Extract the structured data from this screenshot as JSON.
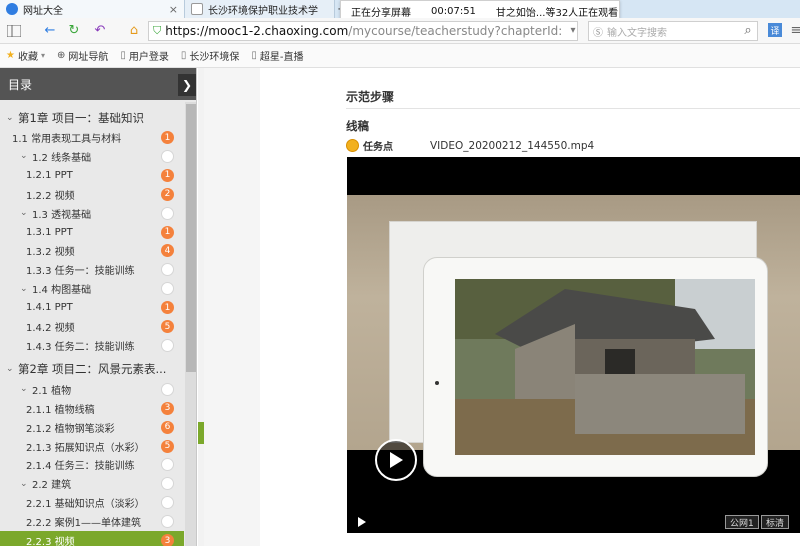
{
  "tabs": [
    {
      "title": "网址大全",
      "close": "×"
    },
    {
      "title": "长沙环境保护职业技术学",
      "close": "×"
    }
  ],
  "new_tab": "+",
  "share_overlay": {
    "status": "正在分享屏幕",
    "elapsed": "00:07:51",
    "viewers": "甘之如饴...等32人正在观看"
  },
  "address": {
    "url_main": "https://mooc1-2.chaoxing.com",
    "url_rest": "/mycourse/teacherstudy?chapterId:",
    "search_placeholder": "输入文字搜索"
  },
  "bookmarks": [
    {
      "label": "收藏"
    },
    {
      "label": "网址导航"
    },
    {
      "label": "用户登录"
    },
    {
      "label": "长沙环境保"
    },
    {
      "label": "超星-直播"
    }
  ],
  "sidebar": {
    "title": "目录",
    "items": [
      {
        "label": "第1章 项目一：基础知识",
        "level": 0,
        "caret": "v",
        "badge": ""
      },
      {
        "label": "1.1 常用表现工具与材料",
        "level": 1,
        "caret": "",
        "badge": "1"
      },
      {
        "label": "1.2 线条基础",
        "level": 2,
        "caret": "v",
        "badge": ""
      },
      {
        "label": "1.2.1 PPT",
        "level": 3,
        "caret": "",
        "badge": "1"
      },
      {
        "label": "1.2.2 视频",
        "level": 3,
        "caret": "",
        "badge": "2"
      },
      {
        "label": "1.3 透视基础",
        "level": 2,
        "caret": "v",
        "badge": ""
      },
      {
        "label": "1.3.1 PPT",
        "level": 3,
        "caret": "",
        "badge": "1"
      },
      {
        "label": "1.3.2 视频",
        "level": 3,
        "caret": "",
        "badge": "4"
      },
      {
        "label": "1.3.3 任务一：技能训练",
        "level": 3,
        "caret": "",
        "badge": ""
      },
      {
        "label": "1.4 构图基础",
        "level": 2,
        "caret": "v",
        "badge": ""
      },
      {
        "label": "1.4.1 PPT",
        "level": 3,
        "caret": "",
        "badge": "1"
      },
      {
        "label": "1.4.2 视频",
        "level": 3,
        "caret": "",
        "badge": "5"
      },
      {
        "label": "1.4.3 任务二：技能训练",
        "level": 3,
        "caret": "",
        "badge": ""
      },
      {
        "label": "第2章 项目二：风景元素表...",
        "level": 0,
        "caret": "v",
        "badge": ""
      },
      {
        "label": "2.1 植物",
        "level": 2,
        "caret": "v",
        "badge": ""
      },
      {
        "label": "2.1.1 植物线稿",
        "level": 3,
        "caret": "",
        "badge": "3"
      },
      {
        "label": "2.1.2 植物钢笔淡彩",
        "level": 3,
        "caret": "",
        "badge": "6"
      },
      {
        "label": "2.1.3 拓展知识点（水彩）",
        "level": 3,
        "caret": "",
        "badge": "5"
      },
      {
        "label": "2.1.4 任务三：技能训练",
        "level": 3,
        "caret": "",
        "badge": ""
      },
      {
        "label": "2.2 建筑",
        "level": 2,
        "caret": "v",
        "badge": ""
      },
      {
        "label": "2.2.1 基础知识点（淡彩）",
        "level": 3,
        "caret": "",
        "badge": ""
      },
      {
        "label": "2.2.2 案例1——单体建筑",
        "level": 3,
        "caret": "",
        "badge": ""
      },
      {
        "label": "2.2.3 视频",
        "level": 3,
        "caret": "",
        "badge": "3",
        "active": true
      }
    ]
  },
  "main": {
    "section_title": "示范步骤",
    "sub_title": "线稿",
    "task_label": "任务点",
    "file_name": "VIDEO_20200212_144550.mp4",
    "video_buttons": [
      "公网1",
      "标清"
    ]
  },
  "colors": {
    "accent_green": "#7ba82b",
    "badge_orange": "#f4813c",
    "sidebar_header": "#545454"
  }
}
